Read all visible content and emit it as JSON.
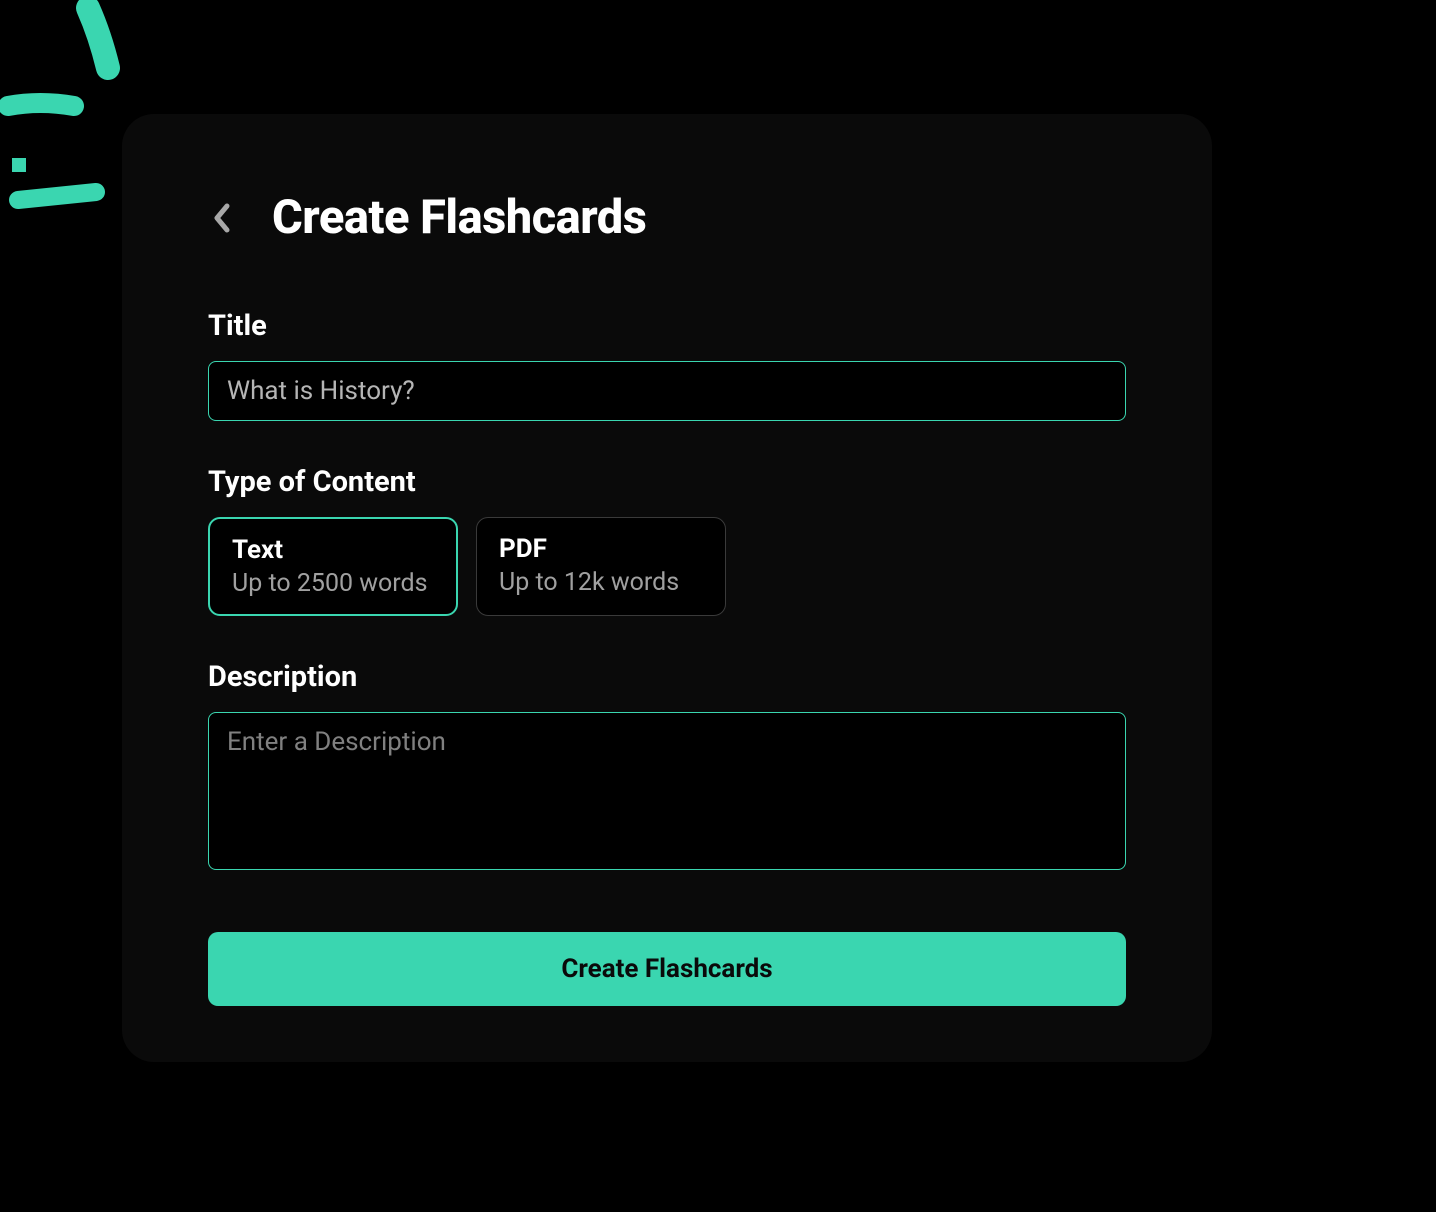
{
  "header": {
    "title": "Create Flashcards"
  },
  "form": {
    "title_label": "Title",
    "title_value": "What is History?",
    "content_type_label": "Type of Content",
    "content_types": [
      {
        "title": "Text",
        "subtitle": "Up to 2500 words",
        "selected": true
      },
      {
        "title": "PDF",
        "subtitle": "Up to 12k words",
        "selected": false
      }
    ],
    "description_label": "Description",
    "description_placeholder": "Enter a Description",
    "description_value": "",
    "submit_label": "Create Flashcards"
  },
  "colors": {
    "accent": "#3ad6b0",
    "card_bg": "#0a0a0a",
    "border_inactive": "#3a3a3a",
    "text_muted": "#a0a0a0"
  }
}
